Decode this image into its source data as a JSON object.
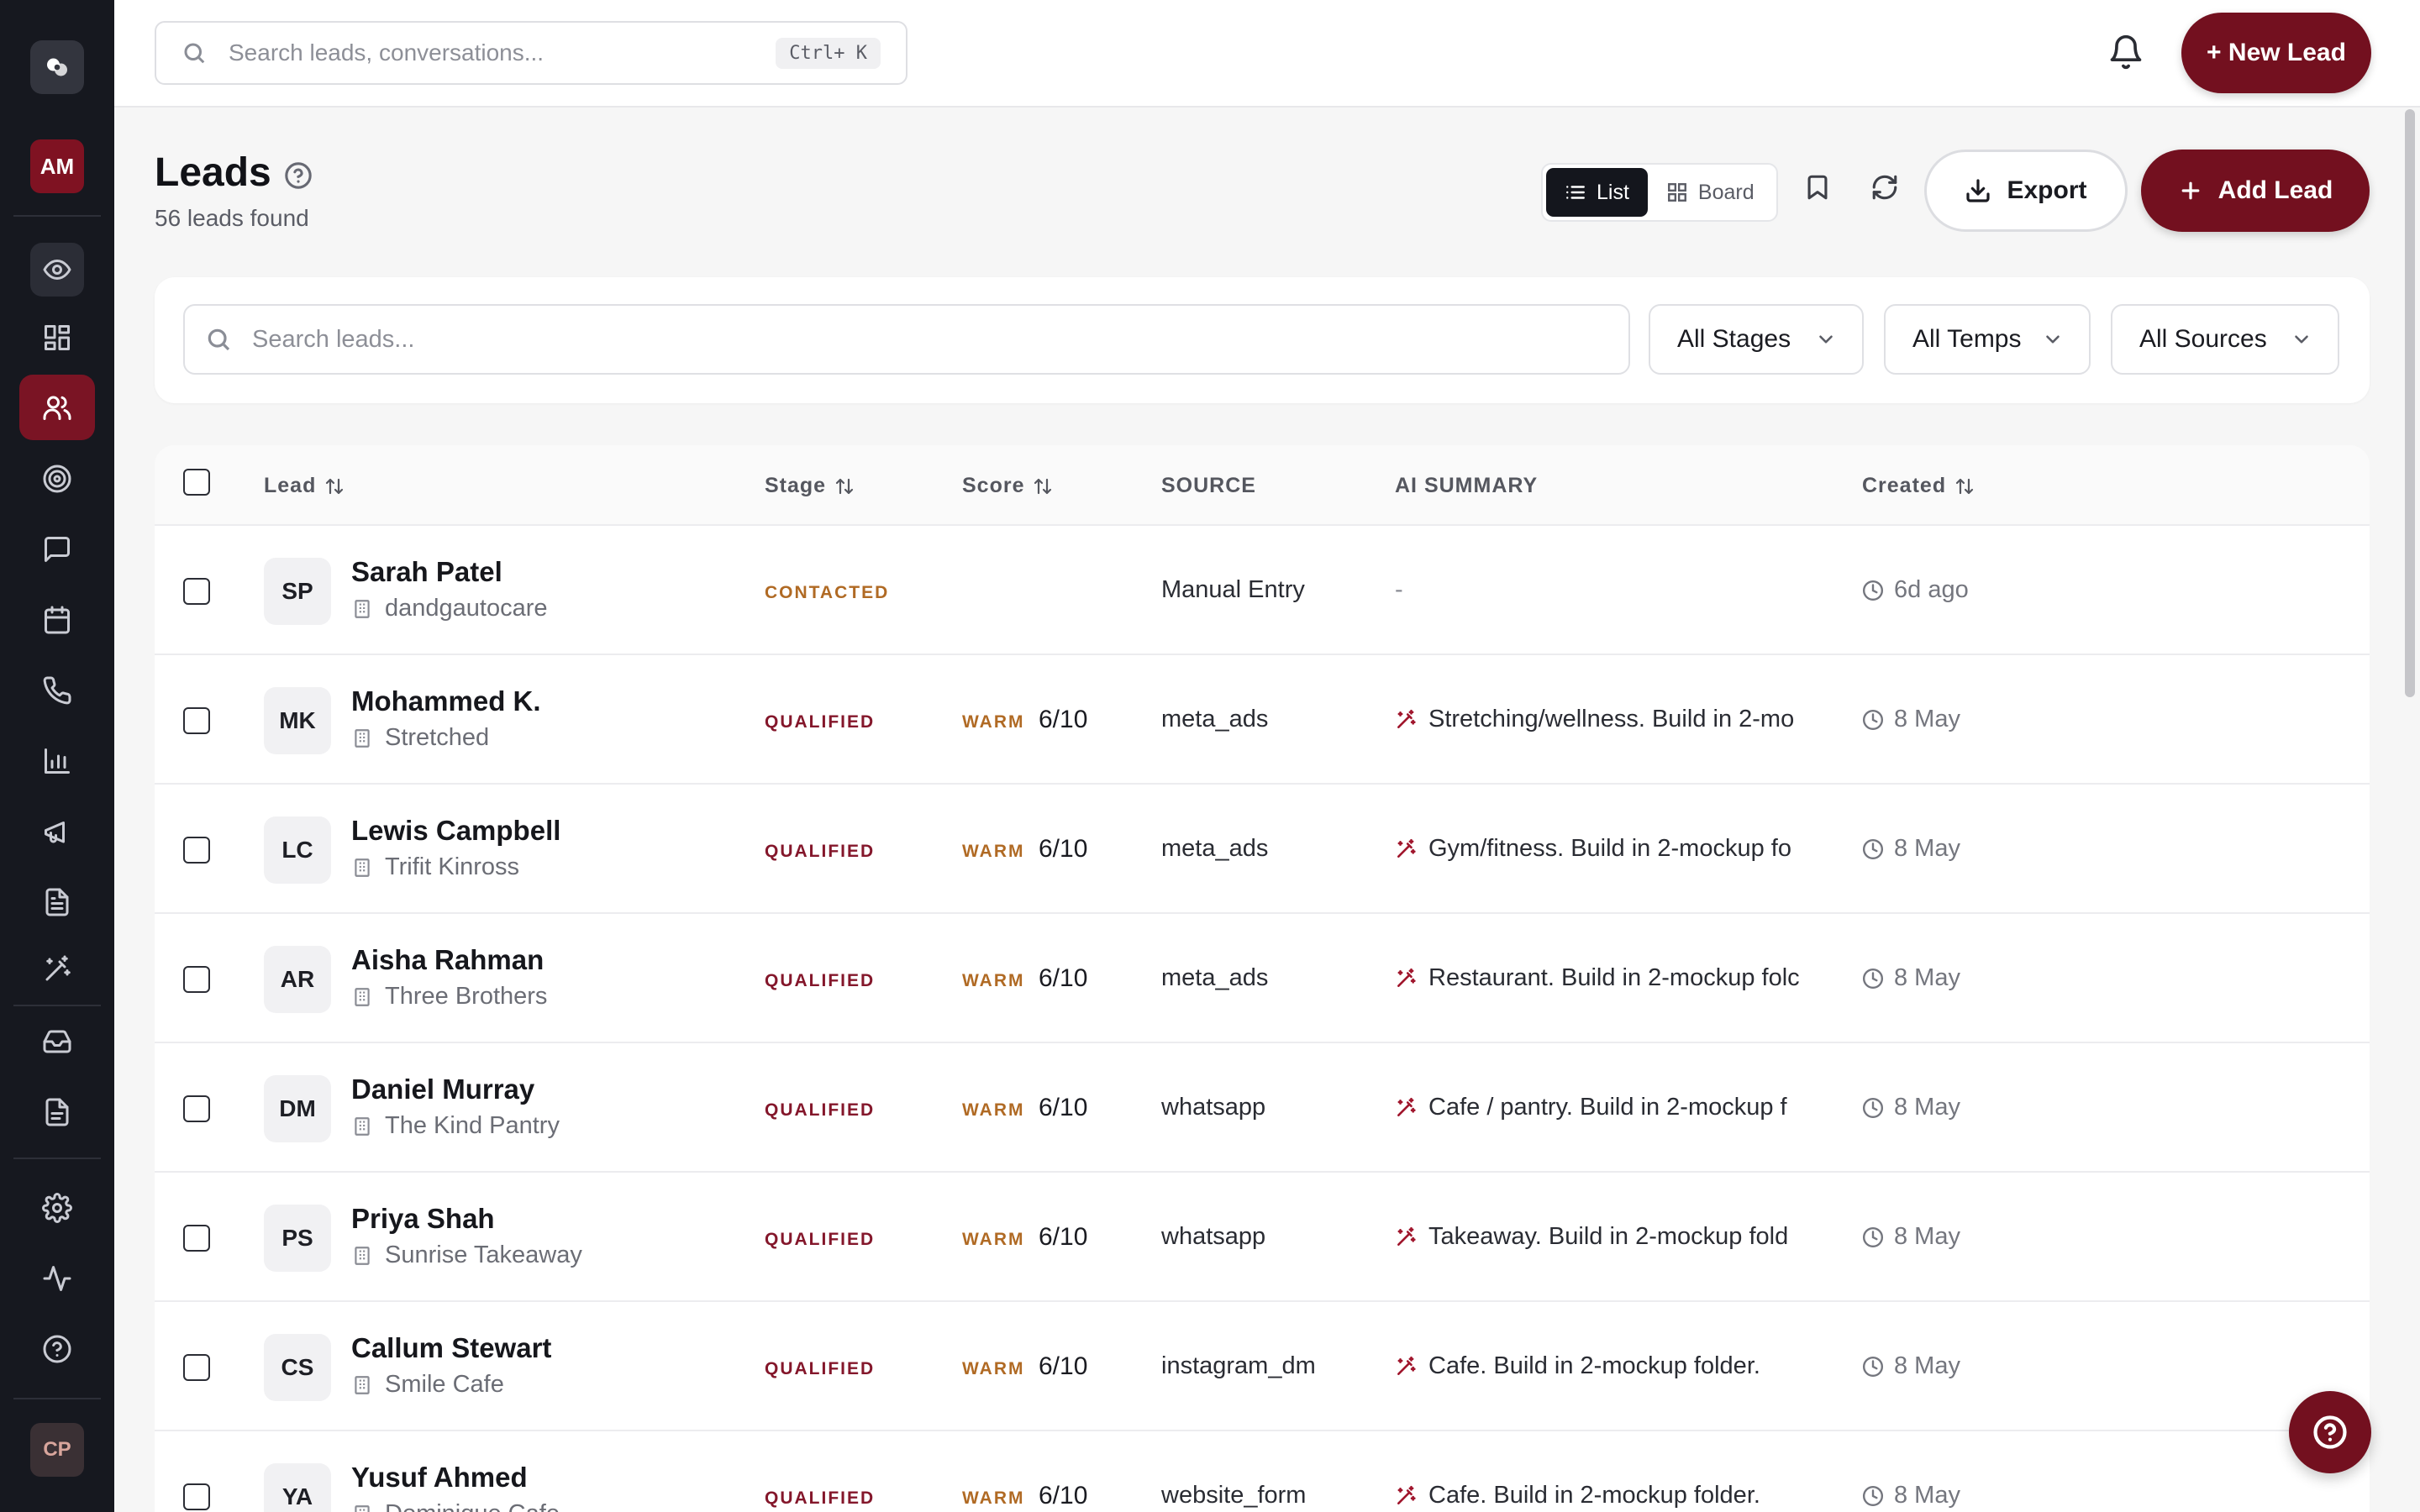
{
  "topbar": {
    "search_placeholder": "Search leads, conversations...",
    "shortcut": "Ctrl+ K",
    "new_lead_label": "+ New Lead"
  },
  "sidebar": {
    "user_initials": "AM",
    "footer_initials": "CP",
    "items": [
      "logo-icon",
      "eye-icon",
      "dashboard-icon",
      "users-icon",
      "target-icon",
      "chat-icon",
      "calendar-icon",
      "phone-icon",
      "bar-chart-icon",
      "megaphone-icon",
      "document-icon",
      "magic-wand-icon",
      "inbox-icon",
      "file-text-icon",
      "settings-icon",
      "activity-icon",
      "help-icon"
    ],
    "active": "users-icon"
  },
  "page": {
    "title": "Leads",
    "count": "56 leads found"
  },
  "toolbar": {
    "list_label": "List",
    "board_label": "Board",
    "export_label": "Export",
    "add_lead_label": "Add Lead"
  },
  "filters": {
    "search_placeholder": "Search leads...",
    "stages": "All Stages",
    "temps": "All Temps",
    "sources": "All Sources"
  },
  "table": {
    "headers": {
      "lead": "Lead",
      "stage": "Stage",
      "score": "Score",
      "source": "SOURCE",
      "ai_summary": "AI SUMMARY",
      "created": "Created"
    },
    "rows": [
      {
        "initials": "SP",
        "name": "Sarah Patel",
        "company": "dandgautocare",
        "stage": "CONTACTED",
        "temp": "",
        "score": "",
        "source": "Manual Entry",
        "summary": "-",
        "created": "6d ago"
      },
      {
        "initials": "MK",
        "name": "Mohammed K.",
        "company": "Stretched",
        "stage": "QUALIFIED",
        "temp": "WARM",
        "score": "6/10",
        "source": "meta_ads",
        "summary": "Stretching/wellness. Build in 2-mo",
        "created": "8 May"
      },
      {
        "initials": "LC",
        "name": "Lewis Campbell",
        "company": "Trifit Kinross",
        "stage": "QUALIFIED",
        "temp": "WARM",
        "score": "6/10",
        "source": "meta_ads",
        "summary": "Gym/fitness. Build in 2-mockup fo",
        "created": "8 May"
      },
      {
        "initials": "AR",
        "name": "Aisha Rahman",
        "company": "Three Brothers",
        "stage": "QUALIFIED",
        "temp": "WARM",
        "score": "6/10",
        "source": "meta_ads",
        "summary": "Restaurant. Build in 2-mockup folc",
        "created": "8 May"
      },
      {
        "initials": "DM",
        "name": "Daniel Murray",
        "company": "The Kind Pantry",
        "stage": "QUALIFIED",
        "temp": "WARM",
        "score": "6/10",
        "source": "whatsapp",
        "summary": "Cafe / pantry. Build in 2-mockup f",
        "created": "8 May"
      },
      {
        "initials": "PS",
        "name": "Priya Shah",
        "company": "Sunrise Takeaway",
        "stage": "QUALIFIED",
        "temp": "WARM",
        "score": "6/10",
        "source": "whatsapp",
        "summary": "Takeaway. Build in 2-mockup fold",
        "created": "8 May"
      },
      {
        "initials": "CS",
        "name": "Callum Stewart",
        "company": "Smile Cafe",
        "stage": "QUALIFIED",
        "temp": "WARM",
        "score": "6/10",
        "source": "instagram_dm",
        "summary": "Cafe. Build in 2-mockup folder.",
        "created": "8 May"
      },
      {
        "initials": "YA",
        "name": "Yusuf Ahmed",
        "company": "Dominique Cafe",
        "stage": "QUALIFIED",
        "temp": "WARM",
        "score": "6/10",
        "source": "website_form",
        "summary": "Cafe. Build in 2-mockup folder.",
        "created": "8 May"
      }
    ]
  },
  "colors": {
    "brand": "#73101f",
    "sidebar_bg": "#16181f",
    "warm": "#b06a24",
    "qualified": "#84172b"
  }
}
